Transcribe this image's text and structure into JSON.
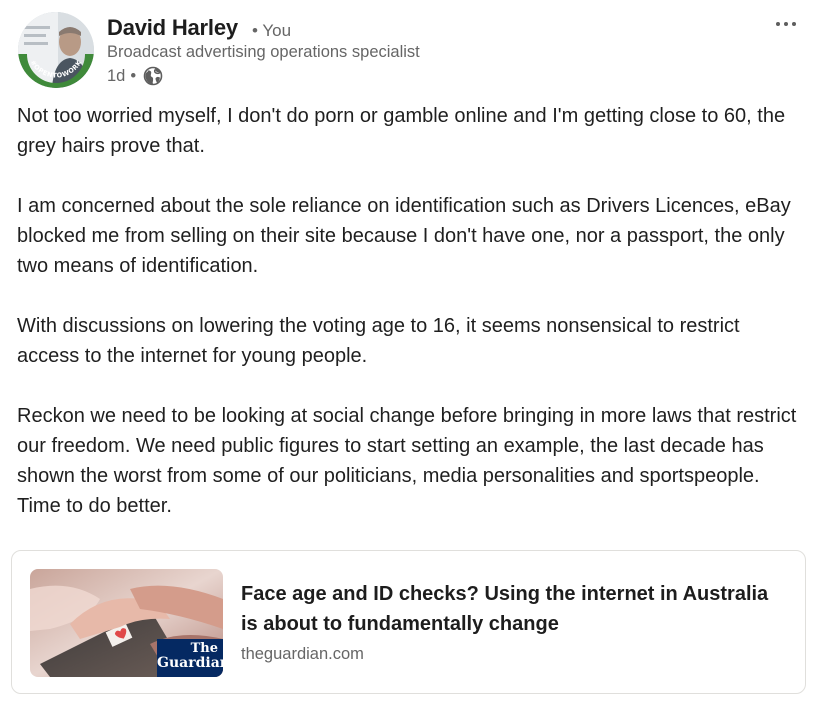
{
  "post": {
    "author": {
      "name": "David Harley",
      "relation": "• You",
      "headline": "Broadcast advertising operations specialist",
      "avatar_badge": "#OPENTOWORK"
    },
    "timestamp": "1d",
    "separator": "•",
    "visibility_icon": "globe-icon",
    "menu_icon": "more-horizontal-icon",
    "paragraphs": [
      "Not too worried myself, I don't do porn or gamble online and I'm getting close to 60, the grey hairs prove that.",
      "I am concerned about the sole reliance on identification such as Drivers Licences, eBay blocked me from selling on their site because I don't have one, nor a passport, the only two means of identification.",
      "With discussions on lowering the voting age to 16, it seems nonsensical to restrict access to the internet for young people.",
      "Reckon we need to be looking at social change before bringing in more laws that restrict our freedom. We need public figures to start setting an example, the last decade has shown the worst from some of our politicians, media personalities and sportspeople. Time to do better."
    ]
  },
  "link_preview": {
    "title": "Face age and ID checks? Using the internet in Australia is about to fundamentally change",
    "domain": "theguardian.com",
    "logo_line1": "The",
    "logo_line2": "Guardian"
  },
  "colors": {
    "open_to_work_green": "#3f8a3a",
    "guardian_navy": "#052962",
    "muted_text": "#666666"
  }
}
